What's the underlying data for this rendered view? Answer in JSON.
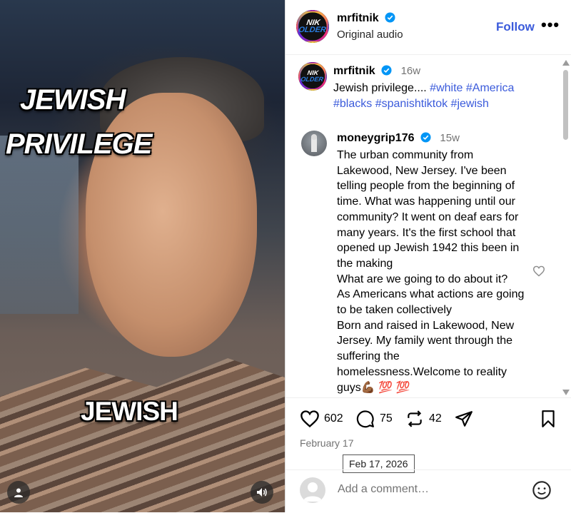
{
  "video": {
    "caption_top_1": "JEWISH",
    "caption_top_2": "PRIVILEGE",
    "caption_bottom": "JEWISH",
    "user_icon": "user-icon",
    "audio_icon": "speaker-icon"
  },
  "header": {
    "username": "mrfitnik",
    "audio": "Original audio",
    "follow": "Follow",
    "more": "•••",
    "logo_line1": "NIK",
    "logo_line2": "OLDER"
  },
  "post": {
    "username": "mrfitnik",
    "age": "16w",
    "text": "Jewish privilege.... ",
    "tags": [
      "#white",
      "#America",
      "#blacks",
      "#spanishtiktok",
      "#jewish"
    ]
  },
  "comment": {
    "username": "moneygrip176",
    "age": "15w",
    "text": "The urban community from Lakewood, New Jersey. I've been telling people from the beginning of time. What was happening until our community? It went on deaf ears for many years. It's the first school that opened up Jewish 1942 this been in the making\nWhat are we going to do about it?\nAs Americans what actions are going to be taken collectively\nBorn and raised in Lakewood, New Jersey. My family went through the suffering the\nhomelessness.Welcome to reality guys💪🏾 💯 💯"
  },
  "actions": {
    "likes": "602",
    "comments": "75",
    "reposts": "42"
  },
  "date": "February 17",
  "tooltip": "Feb 17, 2026",
  "add_comment": {
    "placeholder": "Add a comment…"
  },
  "colors": {
    "accent": "#3b5bdb",
    "muted": "#737373"
  }
}
